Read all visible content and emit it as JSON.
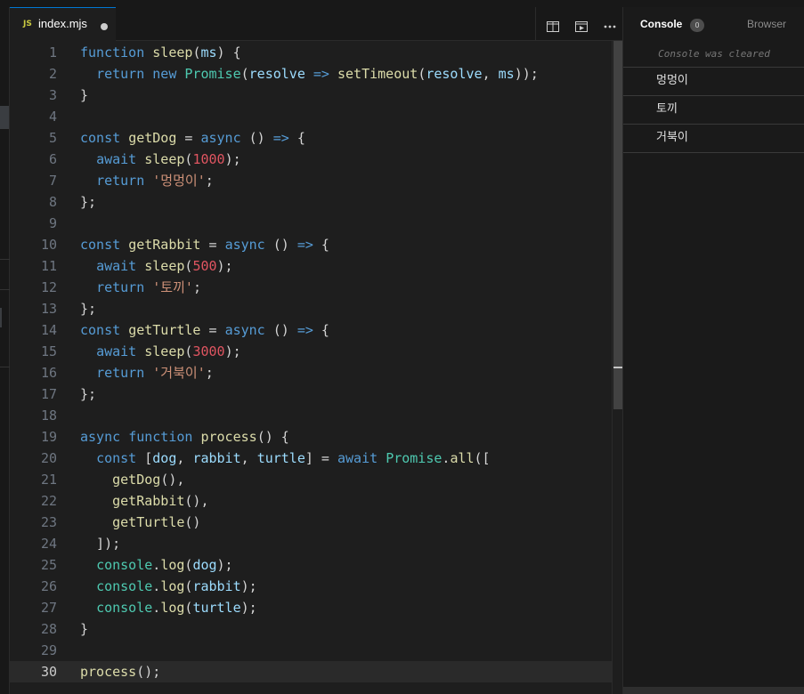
{
  "editor": {
    "tab": {
      "badge": "JS",
      "filename": "index.mjs"
    },
    "lines": [
      {
        "n": "1",
        "t": [
          [
            "k",
            "function"
          ],
          [
            "o",
            " "
          ],
          [
            "f",
            "sleep"
          ],
          [
            "o",
            "("
          ],
          [
            "p",
            "ms"
          ],
          [
            "o",
            ") {"
          ]
        ]
      },
      {
        "n": "2",
        "t": [
          [
            "o",
            "  "
          ],
          [
            "k",
            "return"
          ],
          [
            "o",
            " "
          ],
          [
            "k",
            "new"
          ],
          [
            "o",
            " "
          ],
          [
            "c",
            "Promise"
          ],
          [
            "o",
            "("
          ],
          [
            "p",
            "resolve"
          ],
          [
            "o",
            " "
          ],
          [
            "k",
            "=>"
          ],
          [
            "o",
            " "
          ],
          [
            "f",
            "setTimeout"
          ],
          [
            "o",
            "("
          ],
          [
            "p",
            "resolve"
          ],
          [
            "o",
            ", "
          ],
          [
            "p",
            "ms"
          ],
          [
            "o",
            "));"
          ]
        ]
      },
      {
        "n": "3",
        "t": [
          [
            "o",
            "}"
          ]
        ]
      },
      {
        "n": "4",
        "t": []
      },
      {
        "n": "5",
        "t": [
          [
            "k",
            "const"
          ],
          [
            "o",
            " "
          ],
          [
            "f",
            "getDog"
          ],
          [
            "o",
            " = "
          ],
          [
            "k",
            "async"
          ],
          [
            "o",
            " () "
          ],
          [
            "k",
            "=>"
          ],
          [
            "o",
            " {"
          ]
        ]
      },
      {
        "n": "6",
        "t": [
          [
            "o",
            "  "
          ],
          [
            "k",
            "await"
          ],
          [
            "o",
            " "
          ],
          [
            "f",
            "sleep"
          ],
          [
            "o",
            "("
          ],
          [
            "n",
            "1000"
          ],
          [
            "o",
            ");"
          ]
        ]
      },
      {
        "n": "7",
        "t": [
          [
            "o",
            "  "
          ],
          [
            "k",
            "return"
          ],
          [
            "o",
            " "
          ],
          [
            "s",
            "'멍멍이'"
          ],
          [
            "o",
            ";"
          ]
        ]
      },
      {
        "n": "8",
        "t": [
          [
            "o",
            "};"
          ]
        ]
      },
      {
        "n": "9",
        "t": []
      },
      {
        "n": "10",
        "t": [
          [
            "k",
            "const"
          ],
          [
            "o",
            " "
          ],
          [
            "f",
            "getRabbit"
          ],
          [
            "o",
            " = "
          ],
          [
            "k",
            "async"
          ],
          [
            "o",
            " () "
          ],
          [
            "k",
            "=>"
          ],
          [
            "o",
            " {"
          ]
        ]
      },
      {
        "n": "11",
        "t": [
          [
            "o",
            "  "
          ],
          [
            "k",
            "await"
          ],
          [
            "o",
            " "
          ],
          [
            "f",
            "sleep"
          ],
          [
            "o",
            "("
          ],
          [
            "n",
            "500"
          ],
          [
            "o",
            ");"
          ]
        ]
      },
      {
        "n": "12",
        "t": [
          [
            "o",
            "  "
          ],
          [
            "k",
            "return"
          ],
          [
            "o",
            " "
          ],
          [
            "s",
            "'토끼'"
          ],
          [
            "o",
            ";"
          ]
        ]
      },
      {
        "n": "13",
        "t": [
          [
            "o",
            "};"
          ]
        ]
      },
      {
        "n": "14",
        "t": [
          [
            "k",
            "const"
          ],
          [
            "o",
            " "
          ],
          [
            "f",
            "getTurtle"
          ],
          [
            "o",
            " = "
          ],
          [
            "k",
            "async"
          ],
          [
            "o",
            " () "
          ],
          [
            "k",
            "=>"
          ],
          [
            "o",
            " {"
          ]
        ]
      },
      {
        "n": "15",
        "t": [
          [
            "o",
            "  "
          ],
          [
            "k",
            "await"
          ],
          [
            "o",
            " "
          ],
          [
            "f",
            "sleep"
          ],
          [
            "o",
            "("
          ],
          [
            "n",
            "3000"
          ],
          [
            "o",
            ");"
          ]
        ]
      },
      {
        "n": "16",
        "t": [
          [
            "o",
            "  "
          ],
          [
            "k",
            "return"
          ],
          [
            "o",
            " "
          ],
          [
            "s",
            "'거북이'"
          ],
          [
            "o",
            ";"
          ]
        ]
      },
      {
        "n": "17",
        "t": [
          [
            "o",
            "};"
          ]
        ]
      },
      {
        "n": "18",
        "t": []
      },
      {
        "n": "19",
        "t": [
          [
            "k",
            "async"
          ],
          [
            "o",
            " "
          ],
          [
            "k",
            "function"
          ],
          [
            "o",
            " "
          ],
          [
            "f",
            "process"
          ],
          [
            "o",
            "() {"
          ]
        ]
      },
      {
        "n": "20",
        "t": [
          [
            "o",
            "  "
          ],
          [
            "k",
            "const"
          ],
          [
            "o",
            " ["
          ],
          [
            "p",
            "dog"
          ],
          [
            "o",
            ", "
          ],
          [
            "p",
            "rabbit"
          ],
          [
            "o",
            ", "
          ],
          [
            "p",
            "turtle"
          ],
          [
            "o",
            "] = "
          ],
          [
            "k",
            "await"
          ],
          [
            "o",
            " "
          ],
          [
            "c",
            "Promise"
          ],
          [
            "o",
            "."
          ],
          [
            "f",
            "all"
          ],
          [
            "o",
            "(["
          ]
        ]
      },
      {
        "n": "21",
        "t": [
          [
            "o",
            "    "
          ],
          [
            "f",
            "getDog"
          ],
          [
            "o",
            "(),"
          ]
        ]
      },
      {
        "n": "22",
        "t": [
          [
            "o",
            "    "
          ],
          [
            "f",
            "getRabbit"
          ],
          [
            "o",
            "(),"
          ]
        ]
      },
      {
        "n": "23",
        "t": [
          [
            "o",
            "    "
          ],
          [
            "f",
            "getTurtle"
          ],
          [
            "o",
            "()"
          ]
        ]
      },
      {
        "n": "24",
        "t": [
          [
            "o",
            "  ]);"
          ]
        ]
      },
      {
        "n": "25",
        "t": [
          [
            "o",
            "  "
          ],
          [
            "c",
            "console"
          ],
          [
            "o",
            "."
          ],
          [
            "f",
            "log"
          ],
          [
            "o",
            "("
          ],
          [
            "p",
            "dog"
          ],
          [
            "o",
            ");"
          ]
        ]
      },
      {
        "n": "26",
        "t": [
          [
            "o",
            "  "
          ],
          [
            "c",
            "console"
          ],
          [
            "o",
            "."
          ],
          [
            "f",
            "log"
          ],
          [
            "o",
            "("
          ],
          [
            "p",
            "rabbit"
          ],
          [
            "o",
            ");"
          ]
        ]
      },
      {
        "n": "27",
        "t": [
          [
            "o",
            "  "
          ],
          [
            "c",
            "console"
          ],
          [
            "o",
            "."
          ],
          [
            "f",
            "log"
          ],
          [
            "o",
            "("
          ],
          [
            "p",
            "turtle"
          ],
          [
            "o",
            ");"
          ]
        ]
      },
      {
        "n": "28",
        "t": [
          [
            "o",
            "}"
          ]
        ]
      },
      {
        "n": "29",
        "t": []
      },
      {
        "n": "30",
        "t": [
          [
            "f",
            "process"
          ],
          [
            "o",
            "();"
          ]
        ],
        "current": true
      }
    ]
  },
  "panel": {
    "tabs": {
      "console": "Console",
      "console_count": "0",
      "browser": "Browser"
    },
    "cleared_message": "Console was cleared",
    "logs": [
      "멍멍이",
      "토끼",
      "거북이"
    ]
  },
  "colors": {
    "keyword": "#569cd6",
    "function": "#dcdcaa",
    "param": "#9cdcfe",
    "class": "#4ec9b0",
    "string": "#ce9178",
    "number": "#e05561",
    "accent": "#0078d4"
  }
}
